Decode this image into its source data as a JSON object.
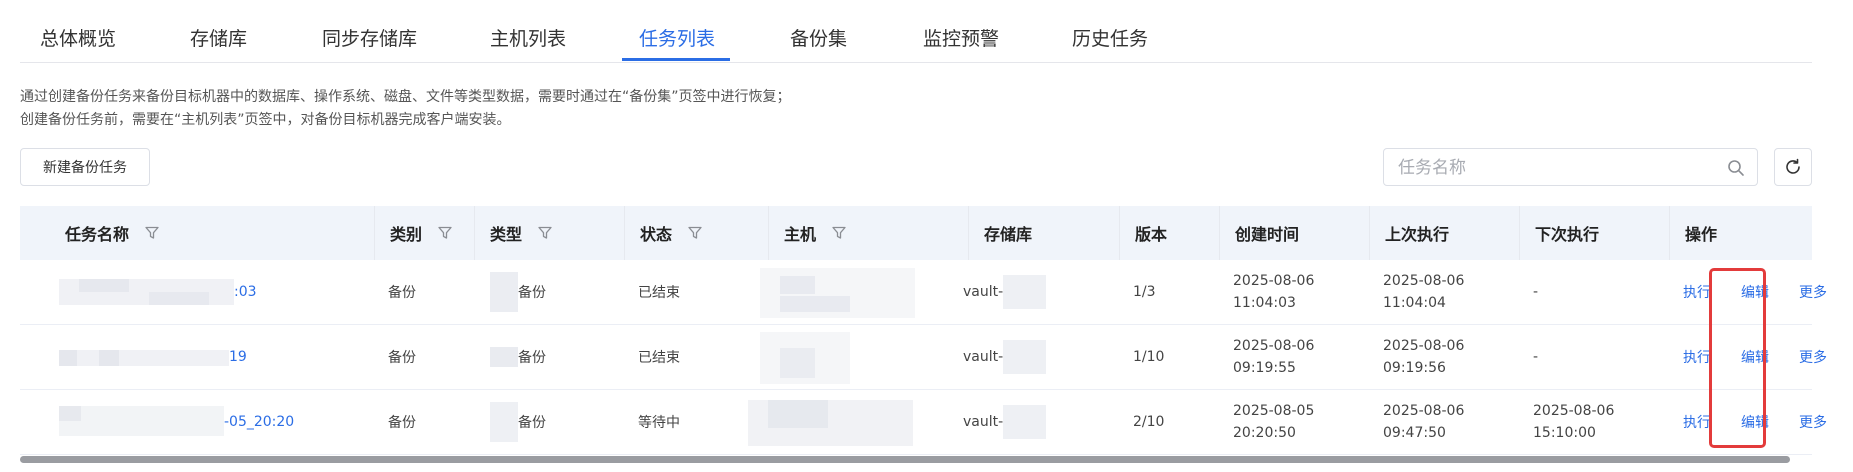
{
  "tabs": [
    {
      "label": "总体概览"
    },
    {
      "label": "存储库"
    },
    {
      "label": "同步存储库"
    },
    {
      "label": "主机列表"
    },
    {
      "label": "任务列表",
      "active": true
    },
    {
      "label": "备份集"
    },
    {
      "label": "监控预警"
    },
    {
      "label": "历史任务"
    }
  ],
  "description": {
    "line1": "通过创建备份任务来备份目标机器中的数据库、操作系统、磁盘、文件等类型数据，需要时通过在“备份集”页签中进行恢复；",
    "line2": "创建备份任务前，需要在“主机列表”页签中，对备份目标机器完成客户端安装。"
  },
  "toolbar": {
    "new_task_label": "新建备份任务",
    "search_placeholder": "任务名称"
  },
  "icons": {
    "search": "search-icon",
    "refresh": "refresh-icon",
    "filter": "filter-icon"
  },
  "colors": {
    "accent": "#2b6de5",
    "highlight": "#e33b3b",
    "header_bg": "#f0f4fa"
  },
  "table": {
    "headers": {
      "name": "任务名称",
      "category": "类别",
      "type": "类型",
      "status": "状态",
      "host": "主机",
      "vault": "存储库",
      "version": "版本",
      "created": "创建时间",
      "last_run": "上次执行",
      "next_run": "下次执行",
      "actions": "操作"
    },
    "rows": [
      {
        "name_visible": ":03",
        "category": "备份",
        "type_visible": "备份",
        "status": "已结束",
        "vault_visible": "vault-",
        "version": "1/3",
        "created_date": "2025-08-06",
        "created_time": "11:04:03",
        "last_date": "2025-08-06",
        "last_time": "11:04:04",
        "next_single": "-",
        "run": "执行",
        "edit": "编辑",
        "more": "更多"
      },
      {
        "name_visible": "19",
        "category": "备份",
        "type_visible": "备份",
        "status": "已结束",
        "vault_visible": "vault-",
        "version": "1/10",
        "created_date": "2025-08-06",
        "created_time": "09:19:55",
        "last_date": "2025-08-06",
        "last_time": "09:19:56",
        "next_single": "-",
        "run": "执行",
        "edit": "编辑",
        "more": "更多"
      },
      {
        "name_visible": "-05_20:20",
        "category": "备份",
        "type_visible": "备份",
        "status": "等待中",
        "vault_visible": "vault-",
        "version": "2/10",
        "created_date": "2025-08-05",
        "created_time": "20:20:50",
        "last_date": "2025-08-06",
        "last_time": "09:47:50",
        "next_date": "2025-08-06",
        "next_time": "15:10:00",
        "run": "执行",
        "edit": "编辑",
        "more": "更多"
      }
    ]
  }
}
